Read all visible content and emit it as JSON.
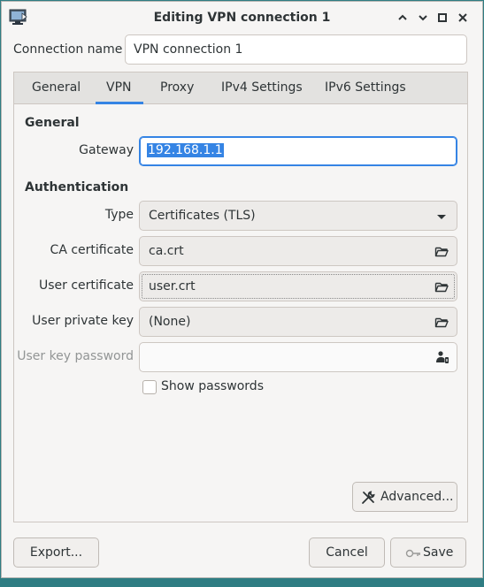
{
  "window": {
    "title": "Editing VPN connection 1",
    "icon": "network-connection-icon"
  },
  "connection_name": {
    "label": "Connection name",
    "value": "VPN connection 1"
  },
  "tabs": [
    {
      "label": "General",
      "active": false
    },
    {
      "label": "VPN",
      "active": true
    },
    {
      "label": "Proxy",
      "active": false
    },
    {
      "label": "IPv4 Settings",
      "active": false
    },
    {
      "label": "IPv6 Settings",
      "active": false
    }
  ],
  "general": {
    "heading": "General",
    "gateway_label": "Gateway",
    "gateway_value": "192.168.1.1"
  },
  "auth": {
    "heading": "Authentication",
    "type_label": "Type",
    "type_value": "Certificates (TLS)",
    "ca_label": "CA certificate",
    "ca_value": "ca.crt",
    "user_cert_label": "User certificate",
    "user_cert_value": "user.crt",
    "user_key_label": "User private key",
    "user_key_value": "(None)",
    "key_password_label": "User key password",
    "key_password_value": "",
    "show_passwords_label": "Show passwords",
    "show_passwords_checked": false
  },
  "buttons": {
    "advanced": "Advanced...",
    "export": "Export...",
    "cancel": "Cancel",
    "save": "Save"
  },
  "colors": {
    "accent": "#3584e4",
    "desktop": "#2f7d83"
  }
}
